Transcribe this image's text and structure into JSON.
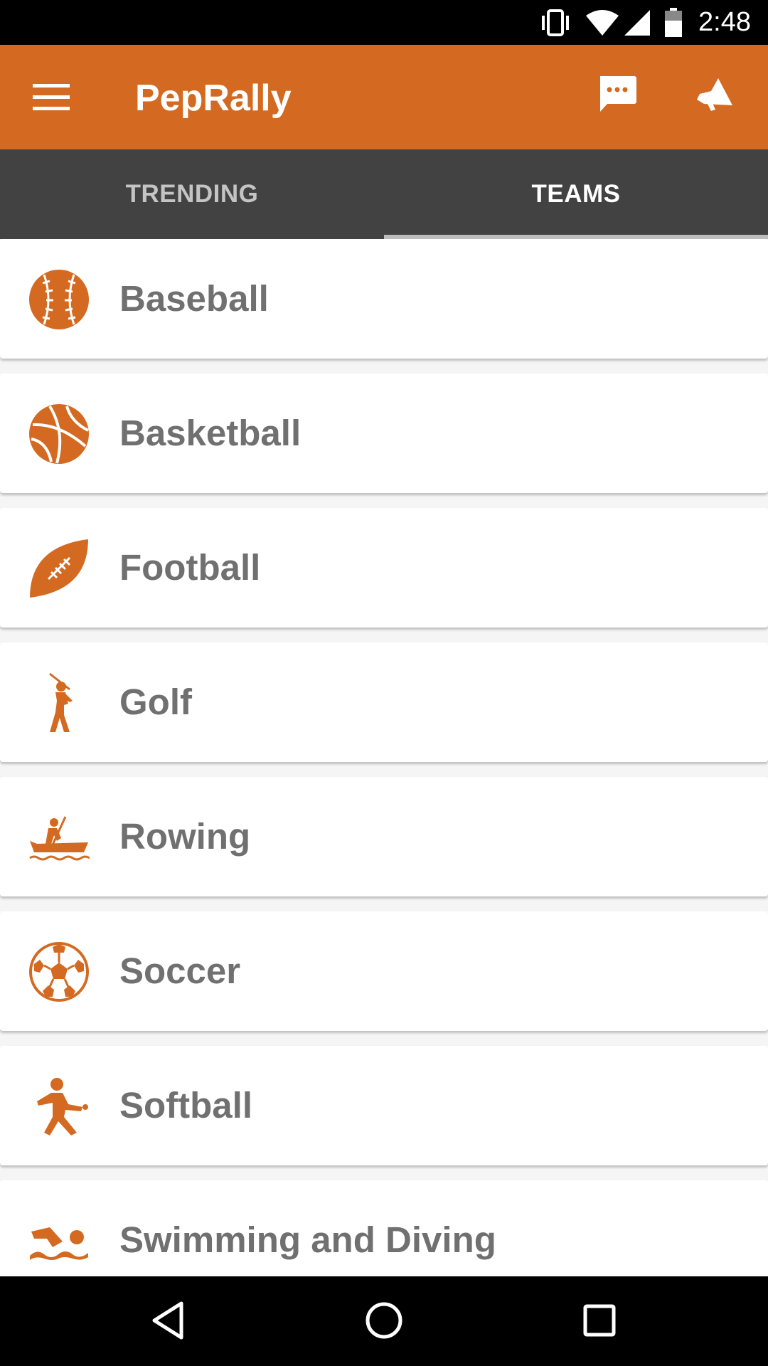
{
  "status_bar": {
    "time": "2:48",
    "icons": [
      "vibrate-icon",
      "wifi-icon",
      "signal-icon",
      "battery-icon"
    ]
  },
  "app_bar": {
    "title": "PepRally",
    "background": "#d46a21",
    "icons": [
      "menu-icon",
      "chat-icon",
      "megaphone-icon"
    ]
  },
  "tabs": [
    {
      "label": "TRENDING",
      "active": false
    },
    {
      "label": "TEAMS",
      "active": true
    }
  ],
  "teams": [
    {
      "label": "Baseball",
      "icon": "baseball-icon"
    },
    {
      "label": "Basketball",
      "icon": "basketball-icon"
    },
    {
      "label": "Football",
      "icon": "football-icon"
    },
    {
      "label": "Golf",
      "icon": "golf-icon"
    },
    {
      "label": "Rowing",
      "icon": "rowing-icon"
    },
    {
      "label": "Soccer",
      "icon": "soccer-icon"
    },
    {
      "label": "Softball",
      "icon": "softball-icon"
    },
    {
      "label": "Swimming and Diving",
      "icon": "swimming-icon"
    }
  ],
  "colors": {
    "accent": "#d46a21",
    "tab_bar": "#424242",
    "label_text": "#707070"
  },
  "nav_bar": {
    "icons": [
      "back-icon",
      "home-icon",
      "recents-icon"
    ]
  }
}
